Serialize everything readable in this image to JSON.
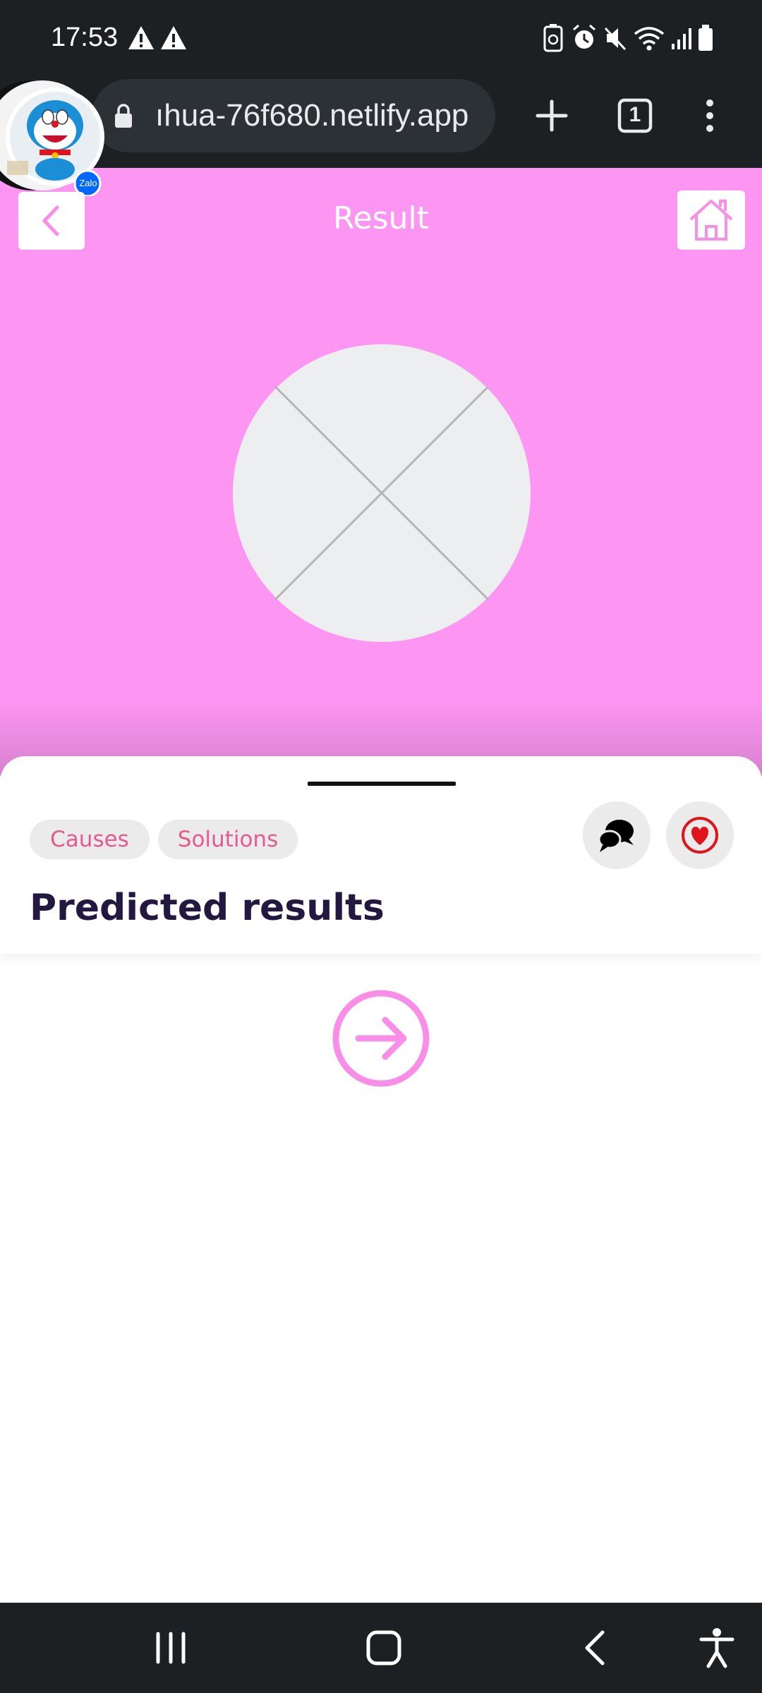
{
  "status_bar": {
    "time": "17:53",
    "icons_left": [
      "warning-icon",
      "warning-icon"
    ],
    "icons_right": [
      "battery-saver-icon",
      "alarm-icon",
      "mute-icon",
      "wifi-icon",
      "signal-icon",
      "battery-icon"
    ]
  },
  "browser": {
    "url": "ıhua-76f680.netlify.app",
    "tab_count": "1",
    "actions": [
      "new-tab",
      "tab-switcher",
      "menu"
    ]
  },
  "chat_bubble": {
    "badge": "Zalo"
  },
  "header": {
    "title": "Result",
    "background": "#fd96f3",
    "accent": "#f98ee9"
  },
  "sheet": {
    "chips": [
      "Causes",
      "Solutions"
    ],
    "title": "Predicted results",
    "chip_text_color": "#e8598c",
    "favorite_color": "#e0141c"
  },
  "nav_bar": {
    "items": [
      "recent-apps",
      "home",
      "back",
      "accessibility"
    ]
  }
}
